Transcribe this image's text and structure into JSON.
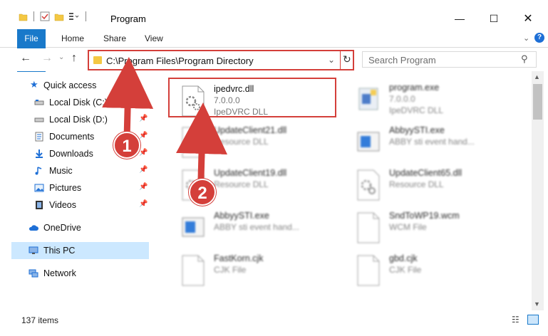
{
  "window": {
    "title": "Program",
    "minimize": "—",
    "maximize": "☐",
    "close": "✕"
  },
  "ribbon": {
    "tabs": [
      {
        "label": "File"
      },
      {
        "label": "Home"
      },
      {
        "label": "Share"
      },
      {
        "label": "View"
      }
    ],
    "expand": "⌄",
    "help": "?"
  },
  "nav": {
    "back": "←",
    "forward": "→",
    "recent": "⌄",
    "up": "↑"
  },
  "address": {
    "path": "C:\\Program Files\\Program Directory",
    "dropdown": "⌄",
    "refresh": "↻"
  },
  "search": {
    "placeholder": "Search Program",
    "icon": "⚲"
  },
  "navpane": {
    "items": [
      {
        "label": "Quick access",
        "icon": "star-icon",
        "pinned": false
      },
      {
        "label": "Local Disk (C:)",
        "icon": "drive-icon",
        "pinned": true
      },
      {
        "label": "Local Disk (D:)",
        "icon": "drive-icon",
        "pinned": true
      },
      {
        "label": "Documents",
        "icon": "documents-icon",
        "pinned": true
      },
      {
        "label": "Downloads",
        "icon": "downloads-icon",
        "pinned": true
      },
      {
        "label": "Music",
        "icon": "music-icon",
        "pinned": true
      },
      {
        "label": "Pictures",
        "icon": "pictures-icon",
        "pinned": true
      },
      {
        "label": "Videos",
        "icon": "videos-icon",
        "pinned": true
      },
      {
        "label": "OneDrive",
        "icon": "cloud-icon",
        "pinned": false
      },
      {
        "label": "This PC",
        "icon": "computer-icon",
        "pinned": false,
        "selected": true
      },
      {
        "label": "Network",
        "icon": "network-icon",
        "pinned": false
      }
    ],
    "pin": "📌"
  },
  "files": [
    {
      "name": "ipedvrc.dll",
      "line2": "7.0.0.0",
      "line3": "IpeDVRC DLL",
      "icon": "dll-icon",
      "highlighted": true
    },
    {
      "name": "program.exe",
      "line2": "7.0.0.0",
      "line3": "IpeDVRC DLL",
      "icon": "exe-icon"
    },
    {
      "name": "UpdateClient21.dll",
      "line2": "Resource DLL",
      "line3": "",
      "icon": "dll-icon"
    },
    {
      "name": "AbbyySTI.exe",
      "line2": "ABBY sti event hand...",
      "line3": "",
      "icon": "exe-icon"
    },
    {
      "name": "UpdateClient19.dll",
      "line2": "Resource DLL",
      "line3": "",
      "icon": "dll-icon"
    },
    {
      "name": "UpdateClient65.dll",
      "line2": "Resource DLL",
      "line3": "",
      "icon": "dll-icon"
    },
    {
      "name": "AbbyySTI.exe",
      "line2": "ABBY sti event hand...",
      "line3": "",
      "icon": "exe-icon"
    },
    {
      "name": "SndToWP19.wcm",
      "line2": "WCM File",
      "line3": "",
      "icon": "file-icon"
    },
    {
      "name": "FastKorn.cjk",
      "line2": "CJK File",
      "line3": "",
      "icon": "file-icon"
    },
    {
      "name": "gbd.cjk",
      "line2": "CJK File",
      "line3": "",
      "icon": "file-icon"
    }
  ],
  "status": {
    "count": "137 items"
  },
  "annotations": {
    "step1": "1",
    "step2": "2",
    "color": "#d43f3a"
  },
  "colors": {
    "accent": "#1979ca",
    "selection": "#cce8ff",
    "highlight": "#d43f3a"
  }
}
